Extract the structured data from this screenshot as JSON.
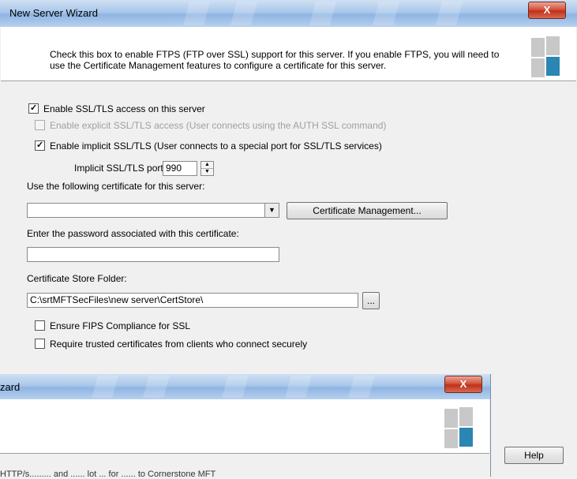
{
  "window_main": {
    "title": "New Server Wizard",
    "close_label": "X",
    "header_text": "Check this box to enable FTPS (FTP over SSL) support for this server. If you enable FTPS, you will need to use the Certificate Management features to configure a certificate for this server.",
    "enable_ssl": {
      "label": "Enable SSL/TLS access on this server",
      "checked": true
    },
    "explicit_ssl": {
      "label": "Enable explicit SSL/TLS access (User connects using the AUTH SSL command)",
      "checked": false,
      "disabled": true
    },
    "implicit_ssl": {
      "label": "Enable implicit SSL/TLS (User connects to a special port for SSL/TLS services)",
      "checked": true
    },
    "implicit_port": {
      "label": "Implicit SSL/TLS port:",
      "value": "990"
    },
    "certificate": {
      "label": "Use the following certificate for this server:",
      "value": ""
    },
    "cert_mgmt_button": "Certificate Management...",
    "password": {
      "label": "Enter the password associated with this certificate:",
      "value": ""
    },
    "store_folder": {
      "label": "Certificate Store Folder:",
      "value": "C:\\srtMFTSecFiles\\new server\\CertStore\\"
    },
    "browse_button": "...",
    "fips": {
      "label": "Ensure FIPS Compliance for SSL",
      "checked": false
    },
    "trusted_certs": {
      "label": "Require trusted certificates from clients who connect securely",
      "checked": false
    },
    "help_button": "Help"
  },
  "window_overlay": {
    "title": "zard",
    "close_label": "X",
    "truncated_text": "HTTP/s......... and ...... lot ... for ...... to Cornerstone MFT"
  },
  "colors": {
    "titlebar": "#a9c7ea",
    "close_button": "#c0301b",
    "logo_gray": "#c8c8c8",
    "logo_teal": "#2a86b2"
  }
}
